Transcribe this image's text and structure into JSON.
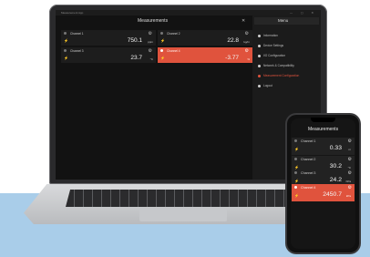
{
  "laptop": {
    "window_title": "Measurement App",
    "measurements_title": "Measurements",
    "menu": {
      "title": "Menu",
      "items": [
        {
          "label": "Information"
        },
        {
          "label": "Device Settings"
        },
        {
          "label": "I/O Configuration"
        },
        {
          "label": "Network & Compatibility"
        },
        {
          "label": "Measurement Configuration"
        },
        {
          "label": "Logout"
        }
      ],
      "active_index": 4
    },
    "channels": [
      {
        "name": "Channel 1",
        "value": "750.1",
        "unit": "ppm"
      },
      {
        "name": "Channel 2",
        "value": "22.8",
        "unit": "kg/m"
      },
      {
        "name": "Channel 3",
        "value": "23.7",
        "unit": "°C"
      },
      {
        "name": "Channel 4",
        "value": "-3.77",
        "unit": "%"
      }
    ]
  },
  "phone": {
    "title": "Measurements",
    "channels": [
      {
        "name": "Channel 1",
        "value": "0.33",
        "unit": "m"
      },
      {
        "name": "Channel 2",
        "value": "30.2",
        "unit": "°C"
      },
      {
        "name": "Channel 3",
        "value": "24.2",
        "unit": "hPa"
      },
      {
        "name": "Channel 4",
        "value": "2450.7",
        "unit": "kPa"
      }
    ]
  },
  "colors": {
    "alarm": "#e0533d",
    "backdrop": "#a9cde9",
    "screen_bg": "#121212"
  }
}
